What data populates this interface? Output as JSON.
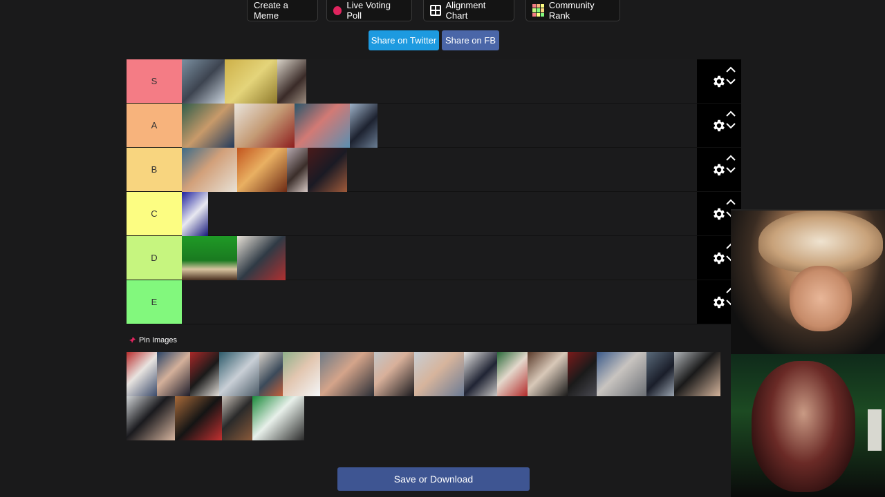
{
  "toolbar": {
    "create_meme": "Create a Meme",
    "live_voting": "Live Voting Poll",
    "alignment_chart": "Alignment Chart",
    "community_rank": "Community Rank"
  },
  "share": {
    "twitter": "Share on Twitter",
    "fb": "Share on FB"
  },
  "tiers": [
    {
      "label": "S",
      "color": "#f47c85"
    },
    {
      "label": "A",
      "color": "#f7b37c"
    },
    {
      "label": "B",
      "color": "#f8d57f"
    },
    {
      "label": "C",
      "color": "#fcfd82"
    },
    {
      "label": "D",
      "color": "#c6f57f"
    },
    {
      "label": "E",
      "color": "#82f87d"
    }
  ],
  "pin": {
    "title": "Pin Images"
  },
  "save": {
    "label": "Save or Download"
  },
  "colors": {
    "twitter": "#1d9ae0",
    "fb": "#4a66a8",
    "save": "#3e5592",
    "background": "#1a1a1b",
    "control": "#000000"
  }
}
